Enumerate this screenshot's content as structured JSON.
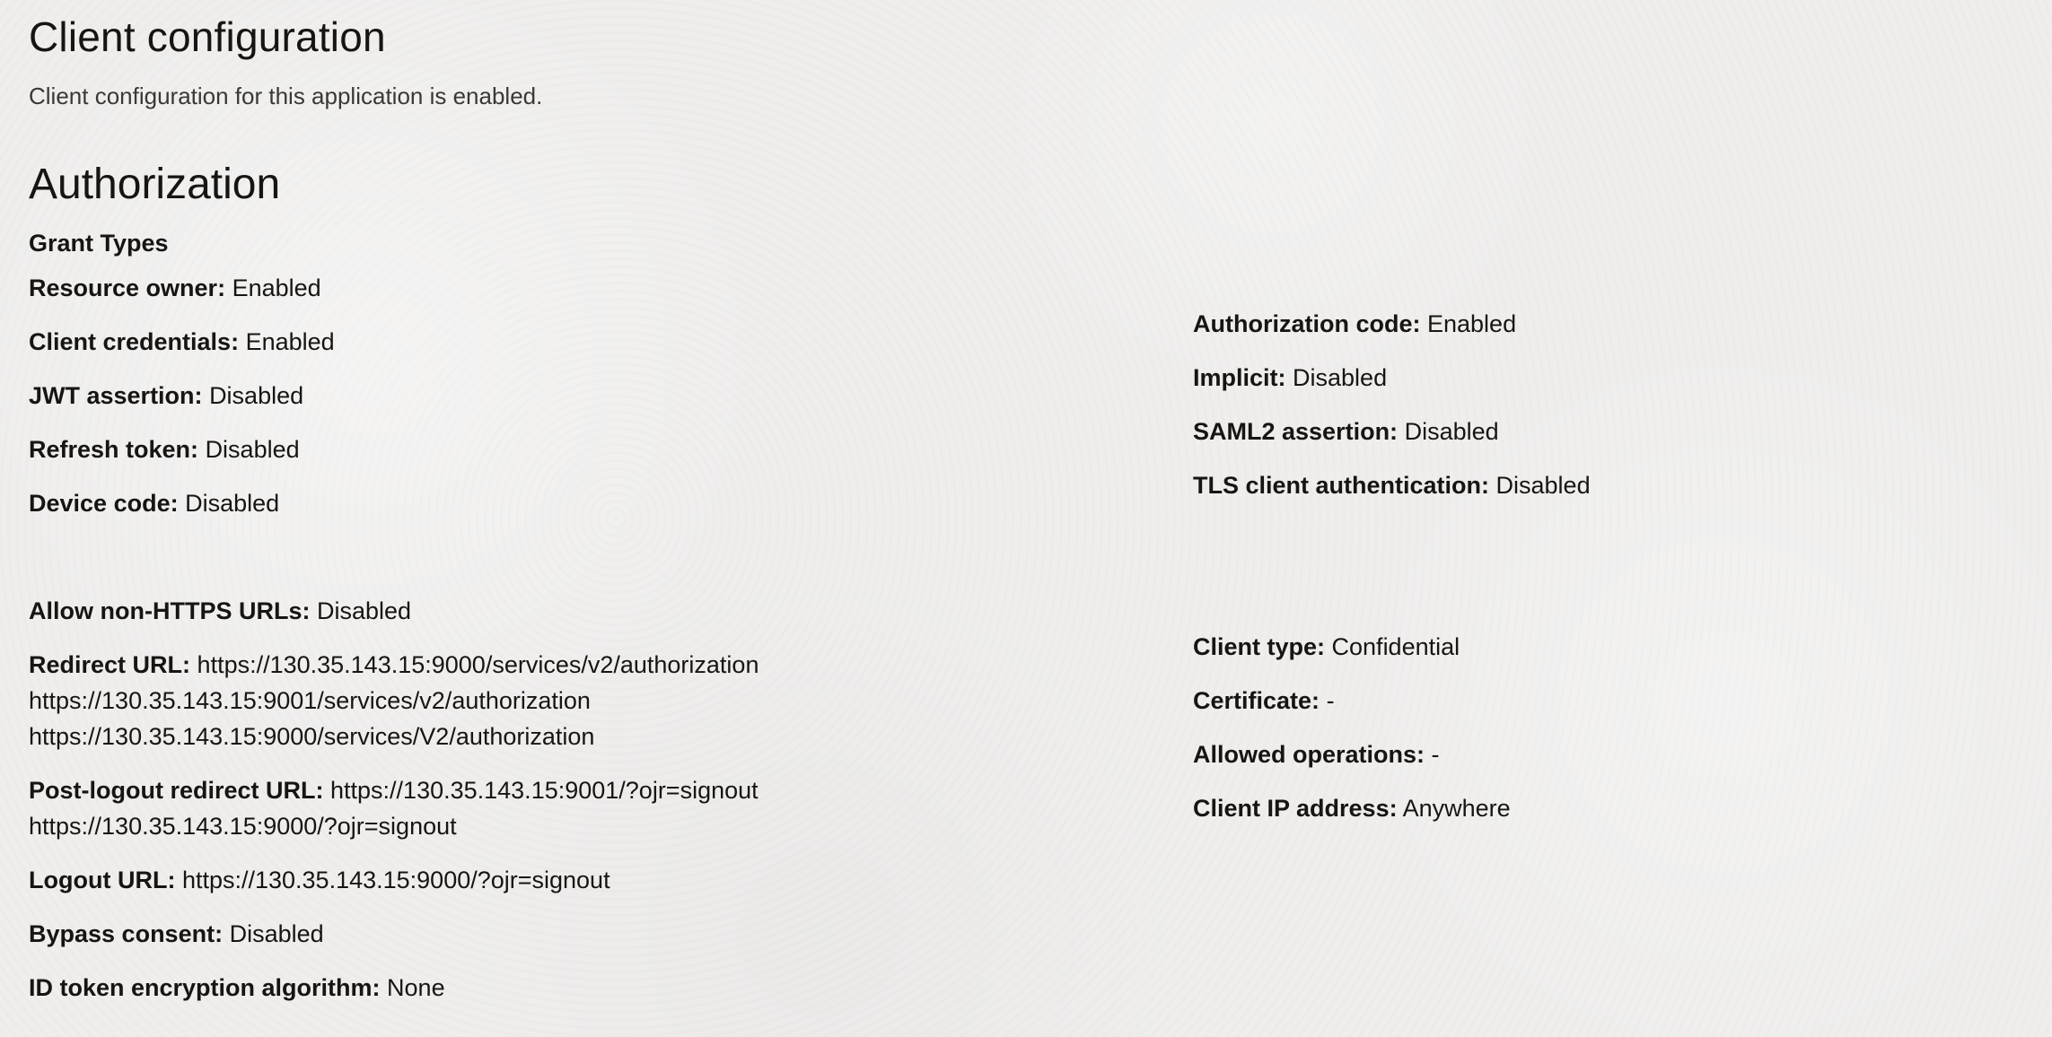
{
  "header": {
    "title": "Client configuration",
    "subtitle": "Client configuration for this application is enabled."
  },
  "authorization": {
    "title": "Authorization",
    "grant_types_heading": "Grant Types",
    "left_grants": [
      {
        "label": "Resource owner:",
        "value": "Enabled"
      },
      {
        "label": "Client credentials:",
        "value": "Enabled"
      },
      {
        "label": "JWT assertion:",
        "value": "Disabled"
      },
      {
        "label": "Refresh token:",
        "value": "Disabled"
      },
      {
        "label": "Device code:",
        "value": "Disabled"
      }
    ],
    "right_grants": [
      {
        "label": "Authorization code:",
        "value": "Enabled"
      },
      {
        "label": "Implicit:",
        "value": "Disabled"
      },
      {
        "label": "SAML2 assertion:",
        "value": "Disabled"
      },
      {
        "label": "TLS client authentication:",
        "value": "Disabled"
      }
    ]
  },
  "settings_left": {
    "allow_non_https": {
      "label": "Allow non-HTTPS URLs:",
      "value": "Disabled"
    },
    "redirect_url": {
      "label": "Redirect URL:",
      "values": [
        "https://130.35.143.15:9000/services/v2/authorization",
        "https://130.35.143.15:9001/services/v2/authorization",
        "https://130.35.143.15:9000/services/V2/authorization"
      ]
    },
    "post_logout_redirect_url": {
      "label": "Post-logout redirect URL:",
      "values": [
        "https://130.35.143.15:9001/?ojr=signout",
        "https://130.35.143.15:9000/?ojr=signout"
      ]
    },
    "logout_url": {
      "label": "Logout URL:",
      "value": "https://130.35.143.15:9000/?ojr=signout"
    },
    "bypass_consent": {
      "label": "Bypass consent:",
      "value": "Disabled"
    },
    "id_token_encryption": {
      "label": "ID token encryption algorithm:",
      "value": "None"
    }
  },
  "settings_right": {
    "client_type": {
      "label": "Client type:",
      "value": "Confidential"
    },
    "certificate": {
      "label": "Certificate:",
      "value": "-"
    },
    "allowed_operations": {
      "label": "Allowed operations:",
      "value": "-"
    },
    "client_ip_address": {
      "label": "Client IP address:",
      "value": "Anywhere"
    }
  }
}
